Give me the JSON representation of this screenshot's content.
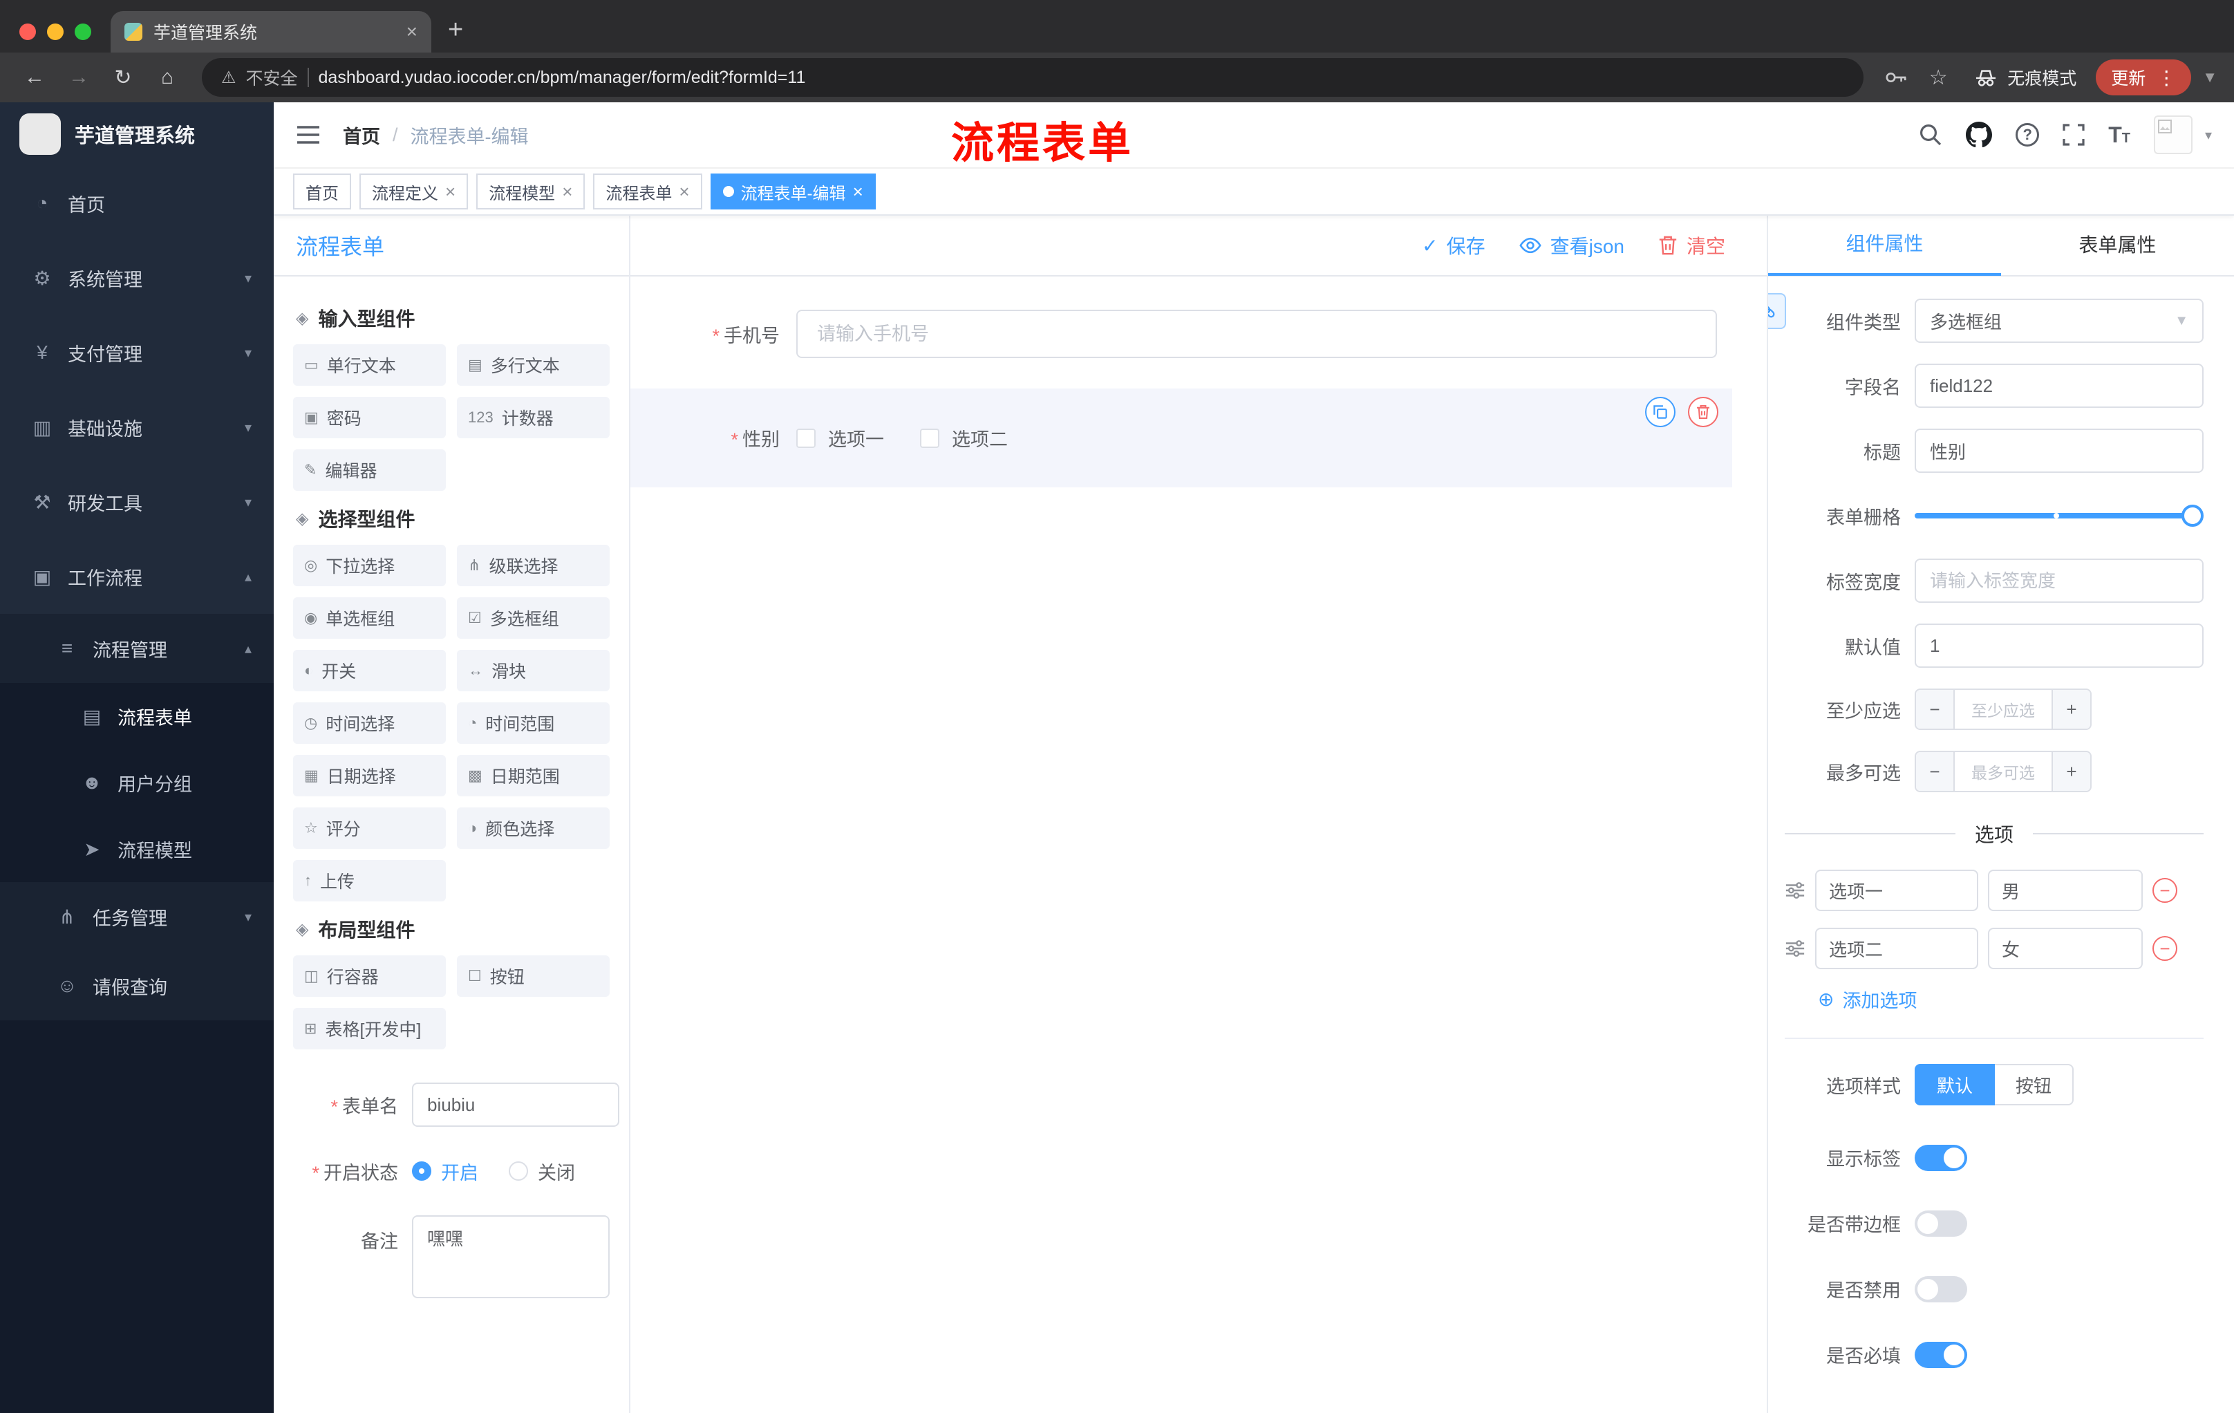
{
  "browser": {
    "tab_title": "芋道管理系统",
    "security_label": "不安全",
    "url": "dashboard.yudao.iocoder.cn/bpm/manager/form/edit?formId=11",
    "incognito_label": "无痕模式",
    "update_label": "更新"
  },
  "sidebar": {
    "logo_title": "芋道管理系统",
    "items": [
      {
        "icon": "◔",
        "label": "首页"
      },
      {
        "icon": "⚙",
        "label": "系统管理"
      },
      {
        "icon": "¥",
        "label": "支付管理"
      },
      {
        "icon": "▥",
        "label": "基础设施"
      },
      {
        "icon": "⚒",
        "label": "研发工具"
      },
      {
        "icon": "▣",
        "label": "工作流程"
      }
    ],
    "process_mgmt": {
      "icon": "≡",
      "label": "流程管理"
    },
    "children": [
      {
        "icon": "▤",
        "label": "流程表单"
      },
      {
        "icon": "☻",
        "label": "用户分组"
      },
      {
        "icon": "➤",
        "label": "流程模型"
      }
    ],
    "task_mgmt": {
      "icon": "⋔",
      "label": "任务管理"
    },
    "leave_query": {
      "icon": "☺",
      "label": "请假查询"
    }
  },
  "header": {
    "breadcrumb_home": "首页",
    "breadcrumb_sep": "/",
    "breadcrumb_current": "流程表单-编辑",
    "annotation": "流程表单"
  },
  "tags": [
    {
      "label": "首页"
    },
    {
      "label": "流程定义"
    },
    {
      "label": "流程模型"
    },
    {
      "label": "流程表单"
    },
    {
      "label": "流程表单-编辑"
    }
  ],
  "designer": {
    "panel_title": "流程表单",
    "actions": {
      "save": "保存",
      "view_json": "查看json",
      "clear": "清空"
    },
    "groups": [
      {
        "title": "输入型组件",
        "items": [
          {
            "icon": "▭",
            "label": "单行文本"
          },
          {
            "icon": "▤",
            "label": "多行文本"
          },
          {
            "icon": "▣",
            "label": "密码"
          },
          {
            "icon": "123",
            "label": "计数器"
          },
          {
            "icon": "✎",
            "label": "编辑器"
          }
        ]
      },
      {
        "title": "选择型组件",
        "items": [
          {
            "icon": "◎",
            "label": "下拉选择"
          },
          {
            "icon": "⋔",
            "label": "级联选择"
          },
          {
            "icon": "◉",
            "label": "单选框组"
          },
          {
            "icon": "☑",
            "label": "多选框组"
          },
          {
            "icon": "◐",
            "label": "开关"
          },
          {
            "icon": "↔",
            "label": "滑块"
          },
          {
            "icon": "◷",
            "label": "时间选择"
          },
          {
            "icon": "◔",
            "label": "时间范围"
          },
          {
            "icon": "▦",
            "label": "日期选择"
          },
          {
            "icon": "▩",
            "label": "日期范围"
          },
          {
            "icon": "☆",
            "label": "评分"
          },
          {
            "icon": "◑",
            "label": "颜色选择"
          },
          {
            "icon": "↑",
            "label": "上传"
          }
        ]
      },
      {
        "title": "布局型组件",
        "items": [
          {
            "icon": "◫",
            "label": "行容器"
          },
          {
            "icon": "☐",
            "label": "按钮"
          },
          {
            "icon": "⊞",
            "label": "表格[开发中]"
          }
        ]
      }
    ],
    "form_meta": {
      "name_label": "表单名",
      "name_value": "biubiu",
      "status_label": "开启状态",
      "status_on": "开启",
      "status_off": "关闭",
      "remark_label": "备注",
      "remark_value": "嘿嘿"
    },
    "canvas": {
      "phone_label": "手机号",
      "phone_placeholder": "请输入手机号",
      "gender_label": "性别",
      "gender_options": [
        "选项一",
        "选项二"
      ]
    }
  },
  "properties": {
    "tabs": [
      "组件属性",
      "表单属性"
    ],
    "fields": {
      "type_label": "组件类型",
      "type_value": "多选框组",
      "field_label": "字段名",
      "field_value": "field122",
      "title_label": "标题",
      "title_value": "性别",
      "grid_label": "表单栅格",
      "label_width_label": "标签宽度",
      "label_width_placeholder": "请输入标签宽度",
      "default_label": "默认值",
      "default_value": "1",
      "min_label": "至少应选",
      "min_placeholder": "至少应选",
      "max_label": "最多可选",
      "max_placeholder": "最多可选"
    },
    "options_section": {
      "title": "选项",
      "rows": [
        {
          "label": "选项一",
          "value": "男"
        },
        {
          "label": "选项二",
          "value": "女"
        }
      ],
      "add_label": "添加选项"
    },
    "style_section": {
      "option_style_label": "选项样式",
      "style_default": "默认",
      "style_button": "按钮",
      "show_label": "显示标签",
      "border_label": "是否带边框",
      "disabled_label": "是否禁用",
      "required_label": "是否必填"
    }
  },
  "colors": {
    "accent": "#409eff",
    "danger": "#f56c6c",
    "annotation_red": "#fb0f00",
    "active_tag": "#409eff"
  }
}
